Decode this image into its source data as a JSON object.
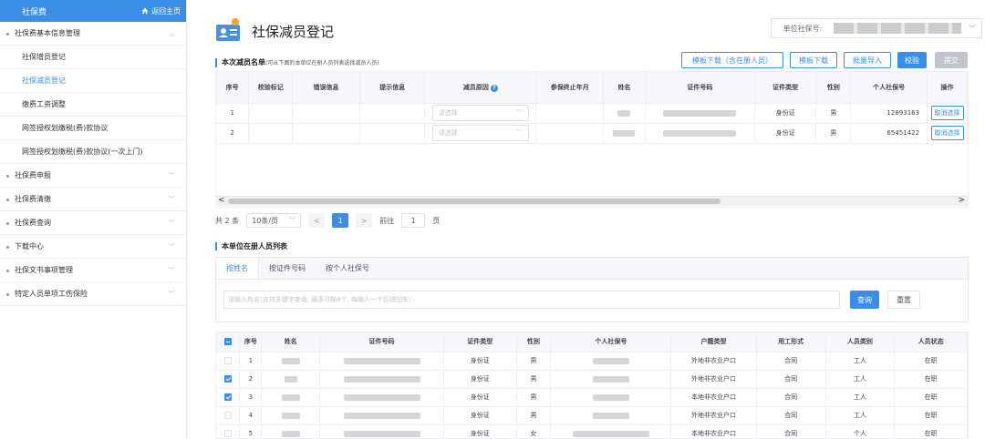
{
  "sidebar": {
    "title": "社保费",
    "home_label": "返回主页",
    "groups": [
      {
        "label": "社保费基本信息管理",
        "expanded": true,
        "items": [
          {
            "label": "社保增员登记",
            "active": false
          },
          {
            "label": "社保减员登记",
            "active": true
          },
          {
            "label": "缴费工资调整",
            "active": false
          },
          {
            "label": "网签授权划缴税(费)款协议",
            "active": false
          },
          {
            "label": "网签授权划缴税(费)款协议(一次上门)",
            "active": false
          }
        ]
      },
      {
        "label": "社保费申报"
      },
      {
        "label": "社保费清缴"
      },
      {
        "label": "社保费查询"
      },
      {
        "label": "下载中心"
      },
      {
        "label": "社保文书事项管理"
      },
      {
        "label": "特定人员单项工伤保险"
      }
    ]
  },
  "header": {
    "title": "社保减员登记",
    "unit_label": "单位社保号:"
  },
  "reduce_section": {
    "title": "本次减员名单",
    "hint": "(可从下面的本单位在册人员列表选择减员人员)",
    "buttons": {
      "template_with_staff": "模板下载（含在册人员）",
      "template": "模板下载",
      "batch_import": "批量导入",
      "validate": "校验",
      "submit": "提交"
    },
    "columns": [
      "序号",
      "校验标记",
      "错误信息",
      "提示信息",
      "减员原因",
      "参保终止年月",
      "姓名",
      "证件号码",
      "证件类型",
      "性别",
      "个人社保号",
      "操作"
    ],
    "select_placeholder": "请选择",
    "rows": [
      {
        "no": "1",
        "id_type": "身份证",
        "gender": "男",
        "ssn": "12893163",
        "action": "取消选择"
      },
      {
        "no": "2",
        "id_type": "身份证",
        "gender": "男",
        "ssn": "65451422",
        "action": "取消选择"
      }
    ],
    "pager": {
      "total": "共 2 条",
      "page_size": "10条/页",
      "current_page": "1",
      "goto_label": "前往",
      "goto_value": "1",
      "page_unit": "页"
    }
  },
  "staff_section": {
    "title": "本单位在册人员列表",
    "tabs": [
      "按姓名",
      "按证件号码",
      "按个人社保号"
    ],
    "active_tab": 0,
    "search_placeholder": "请输入姓名(支持关键字查询, 最多可输8个, 每输入一个后按回车)",
    "search_button": "查询",
    "reset_button": "重置",
    "columns": [
      "序号",
      "姓名",
      "证件号码",
      "证件类型",
      "性别",
      "个人社保号",
      "户籍类型",
      "用工形式",
      "人员类别",
      "人员状态"
    ],
    "rows": [
      {
        "no": "1",
        "checked": false,
        "id_type": "身份证",
        "gender": "男",
        "hukou": "外地非农业户口",
        "employment": "合同",
        "category": "工人",
        "status": "在职"
      },
      {
        "no": "2",
        "checked": true,
        "id_type": "身份证",
        "gender": "男",
        "hukou": "外地非农业户口",
        "employment": "合同",
        "category": "工人",
        "status": "在职"
      },
      {
        "no": "3",
        "checked": true,
        "id_type": "身份证",
        "gender": "男",
        "hukou": "本地非农业户口",
        "employment": "合同",
        "category": "工人",
        "status": "在职"
      },
      {
        "no": "4",
        "checked": false,
        "id_type": "身份证",
        "gender": "男",
        "hukou": "外地非农业户口",
        "employment": "合同",
        "category": "工人",
        "status": "在职"
      },
      {
        "no": "5",
        "checked": false,
        "id_type": "身份证",
        "gender": "女",
        "hukou": "本地非农业户口",
        "employment": "合同",
        "category": "个人",
        "status": "在职"
      }
    ]
  },
  "colors": {
    "accent": "#3a8ee6",
    "disabled": "#c0c4cc"
  }
}
